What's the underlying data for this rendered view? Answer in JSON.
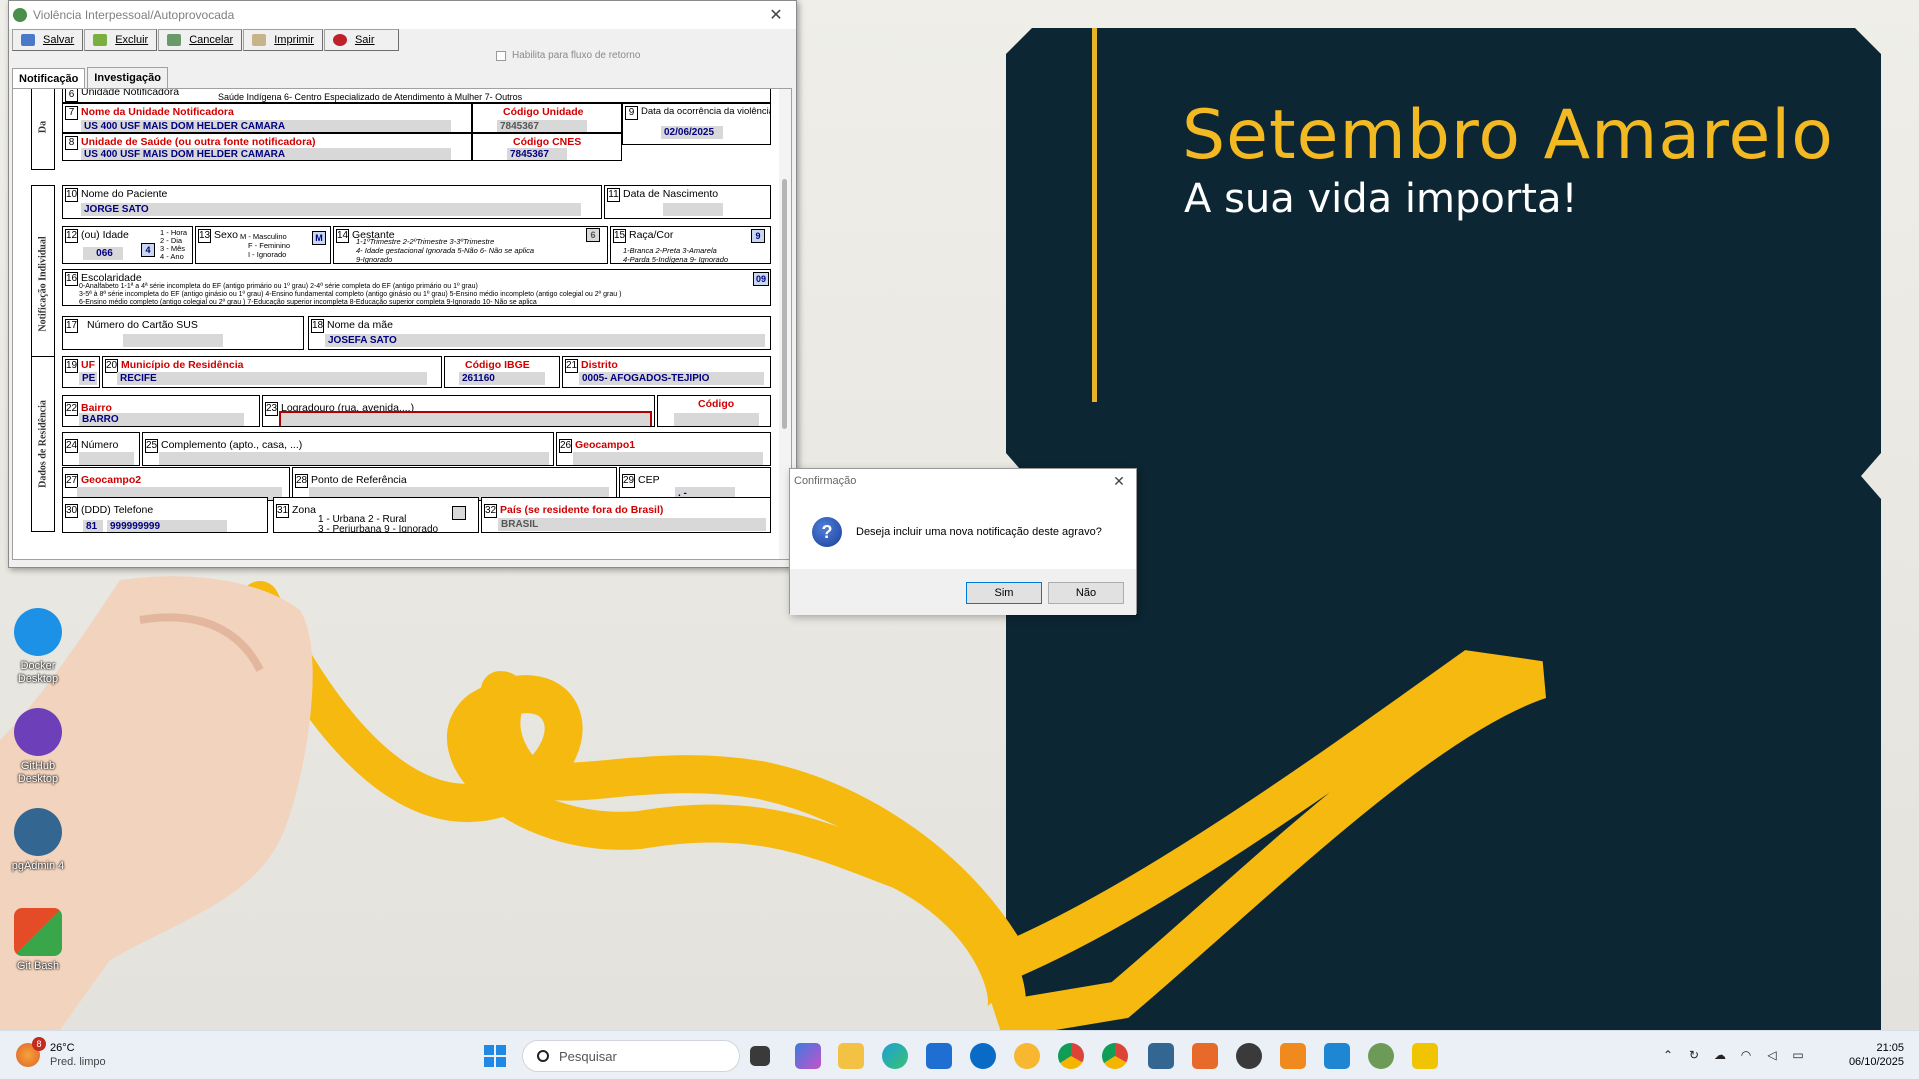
{
  "wallpaper": {
    "title": "Setembro Amarelo",
    "subtitle": "A sua vida importa!",
    "accent_color": "#f2b923",
    "panel_color": "#0d2633"
  },
  "desktop_icons": [
    {
      "label": "Docker Desktop",
      "icon": "docker-icon"
    },
    {
      "label": "GitHub Desktop",
      "icon": "github-icon"
    },
    {
      "label": "pgAdmin 4",
      "icon": "pgadmin-icon"
    },
    {
      "label": "Git Bash",
      "icon": "git-bash-icon"
    }
  ],
  "window": {
    "title": "Violência Interpessoal/Autoprovocada",
    "toolbar": [
      "Salvar",
      "Excluir",
      "Cancelar",
      "Imprimir",
      "Sair"
    ],
    "retorno_checkbox": "Habilita para fluxo de retorno",
    "tabs": [
      "Notificação",
      "Investigação"
    ],
    "sections": {
      "dados_gerais": "Da",
      "notificacao_individual": "Notificação Individual",
      "dados_residencia": "Dados de Residência"
    },
    "fields": {
      "f6_label": "Unidade Notificadora",
      "f6_options": "Saúde Indígena  6- Centro Especializado de Atendimento à Mulher  7- Outros",
      "f7_label": "Nome da Unidade Notificadora",
      "f7_value": "US 400 USF MAIS DOM HELDER CAMARA",
      "codigo_unidade_label": "Código Unidade",
      "codigo_unidade_value": "7845367",
      "f9_label": "Data da ocorrência da violência",
      "f9_value": "02/06/2025",
      "f8_label": "Unidade de Saúde (ou outra fonte notificadora)",
      "f8_value": "US 400 USF MAIS DOM HELDER CAMARA",
      "codigo_cnes_label": "Código CNES",
      "codigo_cnes_value": "7845367",
      "f10_label": "Nome do Paciente",
      "f10_value": "JORGE SATO",
      "f11_label": "Data de Nascimento",
      "f12_label": "(ou) Idade",
      "f12_value": "066",
      "f12_unit": "4",
      "f12_units": [
        "1 - Hora",
        "2 - Dia",
        "3 - Mês",
        "4 - Ano"
      ],
      "f13_label": "Sexo",
      "f13_options": [
        "M - Masculino",
        "F - Feminino",
        "I - Ignorado"
      ],
      "f13_value": "M",
      "f14_label": "Gestante",
      "f14_options": [
        "1-1ºTrimestre   2-2ºTrimestre   3-3ºTrimestre",
        "4- Idade gestacional Ignorada   5-Não   6- Não se aplica",
        "9-Ignorado"
      ],
      "f14_value": "6",
      "f15_label": "Raça/Cor",
      "f15_options": [
        "1-Branca   2-Preta   3-Amarela",
        "4-Parda   5-Indígena   9- Ignorado"
      ],
      "f15_value": "9",
      "f16_label": "Escolaridade",
      "f16_options": [
        "0-Analfabeto   1-1ª a 4ª série incompleta do EF (antigo primário ou 1º grau)   2-4ª série completa do EF (antigo primário ou 1º grau)",
        "3-5ª à 8ª série incompleta do EF (antigo ginásio ou 1º grau)   4-Ensino fundamental completo (antigo ginásio ou 1º grau)   5-Ensino médio incompleto (antigo colegial ou 2º grau )",
        "6-Ensino médio completo (antigo colegial ou 2º grau )   7-Educação superior incompleta   8-Educação superior completa   9-Ignorado   10- Não se aplica"
      ],
      "f16_value": "09",
      "f17_label": "Número do Cartão SUS",
      "f18_label": "Nome da mãe",
      "f18_value": "JOSEFA SATO",
      "f19_label": "UF",
      "f19_value": "PE",
      "f20_label": "Município de Residência",
      "f20_value": "RECIFE",
      "ibge_label": "Código IBGE",
      "ibge_value": "261160",
      "f21_label": "Distrito",
      "f21_value": "0005- AFOGADOS-TEJIPIO",
      "f22_label": "Bairro",
      "f22_value": "BARRO",
      "f23_label": "Logradouro (rua, avenida,...)",
      "codigo_label": "Código",
      "f24_label": "Número",
      "f25_label": "Complemento (apto., casa, ...)",
      "f26_label": "Geocampo1",
      "f27_label": "Geocampo2",
      "f28_label": "Ponto de Referência",
      "f29_label": "CEP",
      "f29_value": ".  -",
      "f30_label": "(DDD) Telefone",
      "f30_ddd": "81",
      "f30_value": "999999999",
      "f31_label": "Zona",
      "f31_options": [
        "1 - Urbana     2 - Rural",
        "3 - Periurbana  9 - Ignorado"
      ],
      "f32_label": "País (se residente fora do Brasil)",
      "f32_value": "BRASIL"
    }
  },
  "dialog": {
    "title": "Confirmação",
    "message": "Deseja incluir uma nova notificação deste agravo?",
    "yes": "Sim",
    "no": "Não"
  },
  "taskbar": {
    "weather_temp": "26°C",
    "weather_desc": "Pred. limpo",
    "weather_badge": "8",
    "search_placeholder": "Pesquisar",
    "time": "21:05",
    "date": "06/10/2025"
  }
}
